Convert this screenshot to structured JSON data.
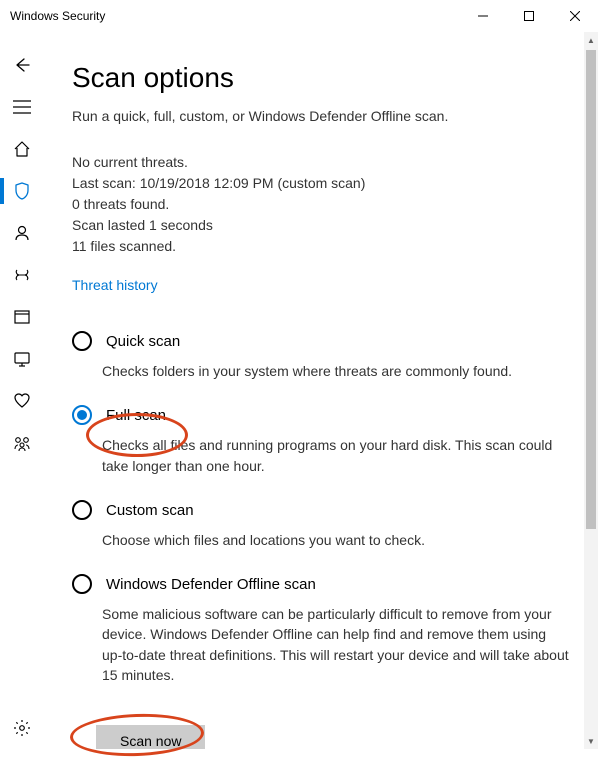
{
  "window": {
    "title": "Windows Security"
  },
  "header": {
    "page_title": "Scan options",
    "subtitle": "Run a quick, full, custom, or Windows Defender Offline scan."
  },
  "status": {
    "no_threats": "No current threats.",
    "last_scan": "Last scan: 10/19/2018 12:09 PM (custom scan)",
    "threats_found": "0 threats found.",
    "scan_duration": "Scan lasted 1 seconds",
    "files_scanned": "11 files scanned."
  },
  "links": {
    "threat_history": "Threat history"
  },
  "scan_options": [
    {
      "label": "Quick scan",
      "desc": "Checks folders in your system where threats are commonly found.",
      "selected": false
    },
    {
      "label": "Full scan",
      "desc": "Checks all files and running programs on your hard disk. This scan could take longer than one hour.",
      "selected": true
    },
    {
      "label": "Custom scan",
      "desc": "Choose which files and locations you want to check.",
      "selected": false
    },
    {
      "label": "Windows Defender Offline scan",
      "desc": "Some malicious software can be particularly difficult to remove from your device. Windows Defender Offline can help find and remove them using up-to-date threat definitions. This will restart your device and will take about 15 minutes.",
      "selected": false
    }
  ],
  "buttons": {
    "scan_now": "Scan now"
  },
  "sidebar": {
    "items": [
      {
        "icon": "back"
      },
      {
        "icon": "menu"
      },
      {
        "icon": "home"
      },
      {
        "icon": "shield",
        "active": true
      },
      {
        "icon": "account"
      },
      {
        "icon": "firewall"
      },
      {
        "icon": "app-browser"
      },
      {
        "icon": "device-security"
      },
      {
        "icon": "device-health"
      },
      {
        "icon": "family"
      }
    ],
    "settings_icon": "settings"
  }
}
